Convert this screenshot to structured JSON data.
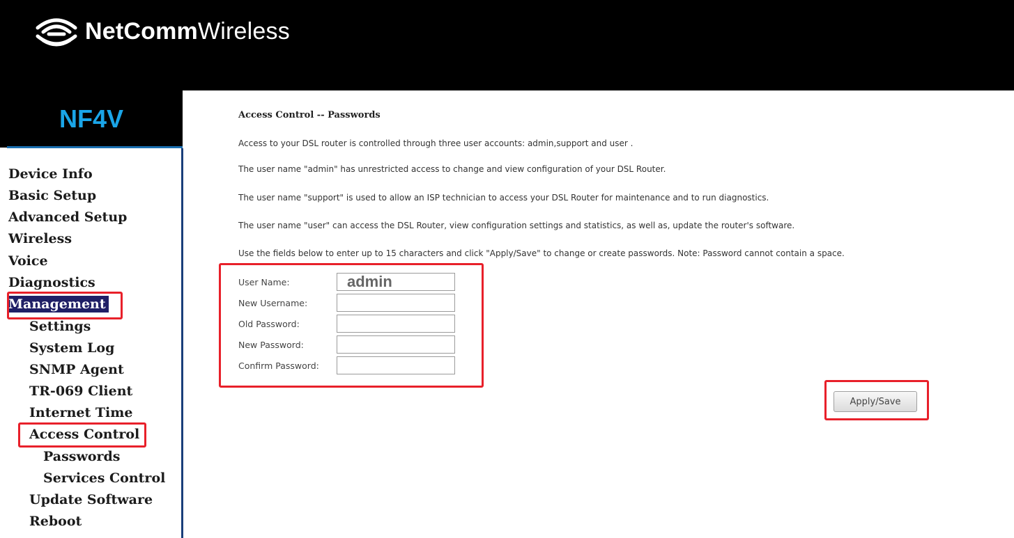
{
  "header": {
    "brand_bold": "NetComm",
    "brand_light": "Wireless",
    "model": "NF4V"
  },
  "sidebar": {
    "items": [
      {
        "label": "Device Info"
      },
      {
        "label": "Basic Setup"
      },
      {
        "label": "Advanced Setup"
      },
      {
        "label": "Wireless"
      },
      {
        "label": "Voice"
      },
      {
        "label": "Diagnostics"
      },
      {
        "label": "Management"
      },
      {
        "label": "Settings"
      },
      {
        "label": "System Log"
      },
      {
        "label": "SNMP Agent"
      },
      {
        "label": "TR-069 Client"
      },
      {
        "label": "Internet Time"
      },
      {
        "label": "Access Control"
      },
      {
        "label": "Passwords"
      },
      {
        "label": "Services Control"
      },
      {
        "label": "Update Software"
      },
      {
        "label": "Reboot"
      }
    ]
  },
  "main": {
    "title": "Access Control -- Passwords",
    "paragraphs": [
      "Access to your DSL router is controlled through three user accounts: admin,support and user .",
      "The user name \"admin\" has unrestricted access to change and view configuration of your DSL Router.",
      "The user name \"support\" is used to allow an ISP technician to access your DSL Router for maintenance and to run diagnostics.",
      "The user name \"user\" can access the DSL Router, view configuration settings and statistics, as well as, update the router's software.",
      "Use the fields below to enter up to 15 characters and click \"Apply/Save\" to change or create passwords. Note: Password cannot contain a space."
    ],
    "form": {
      "user_name_label": "User Name:",
      "user_name_value": "admin",
      "new_username_label": "New Username:",
      "old_password_label": "Old Password:",
      "new_password_label": "New Password:",
      "confirm_password_label": "Confirm Password:"
    },
    "apply_label": "Apply/Save"
  },
  "colors": {
    "accent": "#1aa5e8",
    "highlight": "#e8202a",
    "active_nav": "#1f1f66"
  }
}
